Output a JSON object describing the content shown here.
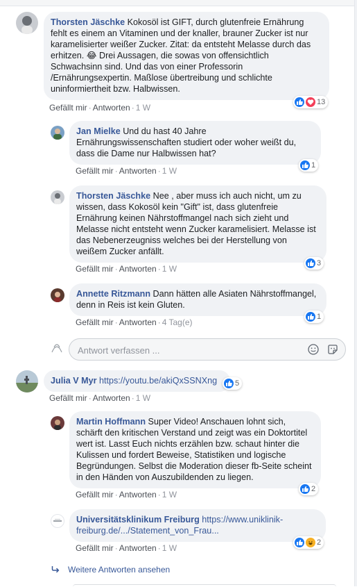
{
  "comments": [
    {
      "author": "Thorsten Jäschke",
      "text": "Kokosöl ist GIFT, durch glutenfreie Ernährung fehlt es einem an Vitaminen und der knaller, brauner Zucker ist nur karamelisierter weißer Zucker. Zitat: da entsteht Melasse durch das erhitzen. 😂 Drei Aussagen, die sowas von offensichtlich Schwachsinn sind. Und das von einer Professorin /Ernährungsexpertin. Maßlose übertreibung und schlichte uninformiertheit bzw. Halbwissen.",
      "like": "Gefällt mir",
      "reply": "Antworten",
      "time": "1 W",
      "reactions": [
        "like",
        "love"
      ],
      "reaction_count": "13"
    },
    {
      "author": "Jan Mielke",
      "text": "Und du hast 40 Jahre Ernährungswissenschaften studiert oder woher weißt du, dass die Dame nur Halbwissen hat?",
      "like": "Gefällt mir",
      "reply": "Antworten",
      "time": "1 W",
      "reactions": [
        "like"
      ],
      "reaction_count": "1"
    },
    {
      "author": "Thorsten Jäschke",
      "text": "Nee , aber muss ich auch nicht, um zu wissen, dass Kokosöl kein \"Gift\" ist, dass glutenfreie Ernährung keinen Nährstoffmangel nach sich zieht und Melasse nicht entsteht wenn Zucker karamelisiert. Melasse ist das Nebenerzeugniss welches bei der Herstellung von weißem Zucker anfällt.",
      "like": "Gefällt mir",
      "reply": "Antworten",
      "time": "1 W",
      "reactions": [
        "like"
      ],
      "reaction_count": "3"
    },
    {
      "author": "Annette Ritzmann",
      "text": "Dann hätten alle Asiaten Nährstoffmangel, denn in Reis ist kein Gluten.",
      "like": "Gefällt mir",
      "reply": "Antworten",
      "time": "4 Tag(e)",
      "reactions": [
        "like"
      ],
      "reaction_count": "1"
    },
    {
      "author": "Julia V Myr",
      "text": "https://youtu.be/akiQxSSNXng",
      "like": "Gefällt mir",
      "reply": "Antworten",
      "time": "1 W",
      "reactions": [
        "like"
      ],
      "reaction_count": "5"
    },
    {
      "author": "Martin Hoffmann",
      "text": "Super Video! Anschauen lohnt sich, schärft den kritischen Verstand und zeigt was ein Doktortitel wert ist. Lasst Euch nichts erzählen bzw. schaut hinter die Kulissen und fordert Beweise, Statistiken und logische Begründungen. Selbst die Moderation dieser fb-Seite scheint in den Händen von Auszubildenden zu liegen.",
      "like": "Gefällt mir",
      "reply": "Antworten",
      "time": "1 W",
      "reactions": [
        "like"
      ],
      "reaction_count": "2"
    },
    {
      "author": "Universitätsklinikum Freiburg",
      "text": "https://www.uniklinik-freiburg.de/.../Statement_von_Frau...",
      "like": "Gefällt mir",
      "reply": "Antworten",
      "time": "1 W",
      "reactions": [
        "like",
        "haha"
      ],
      "reaction_count": "2"
    }
  ],
  "reply_box": {
    "placeholder": "Antwort verfassen ...",
    "value": ""
  },
  "more_replies": "Weitere Antworten ansehen",
  "colors": {
    "link": "#385898",
    "bubble": "#f0f2f5",
    "like": "#1877f2",
    "love": "#f33e58",
    "haha": "#f7b125"
  }
}
